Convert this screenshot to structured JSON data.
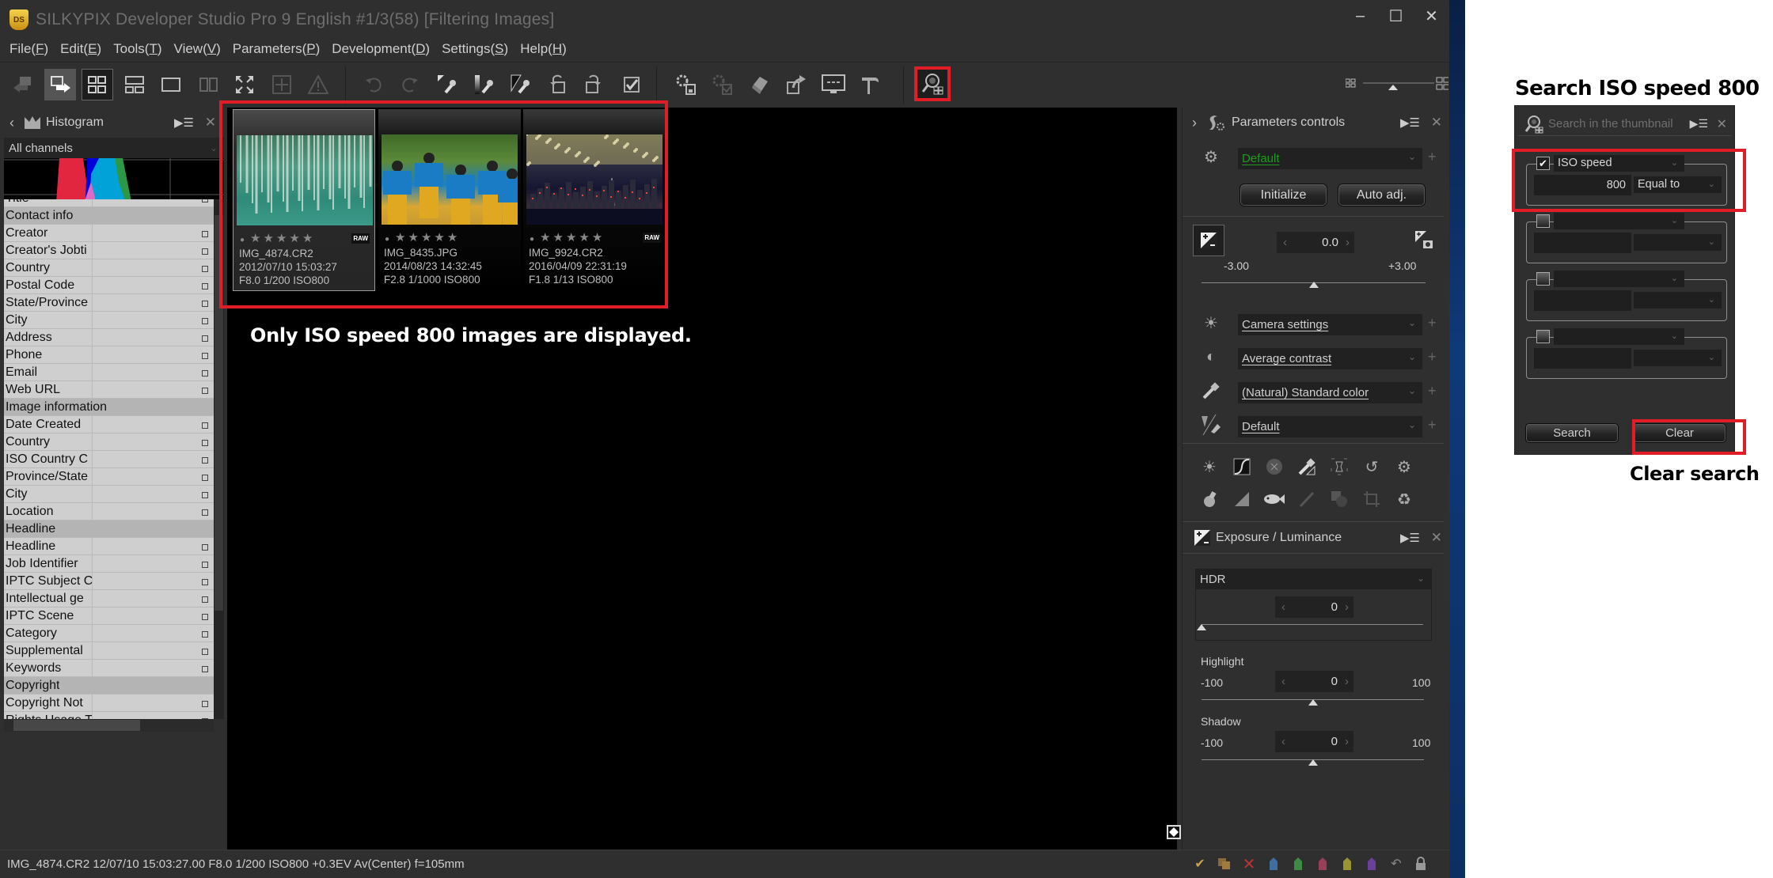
{
  "window": {
    "title": "SILKYPIX Developer Studio Pro 9 English   #1/3(58) [Filtering Images]",
    "logo": "DS",
    "controls": {
      "minimize": "–",
      "maximize": "☐",
      "close": "✕"
    }
  },
  "menu": [
    {
      "label": "File",
      "key": "F"
    },
    {
      "label": "Edit",
      "key": "E"
    },
    {
      "label": "Tools",
      "key": "T"
    },
    {
      "label": "View",
      "key": "V"
    },
    {
      "label": "Parameters",
      "key": "P"
    },
    {
      "label": "Development",
      "key": "D"
    },
    {
      "label": "Settings",
      "key": "S"
    },
    {
      "label": "Help",
      "key": "H"
    }
  ],
  "toolbar": {
    "icons": [
      "back-icon",
      "forward-icon",
      "grid-view-icon",
      "combined-view-icon",
      "preview-view-icon",
      "compare-view-icon",
      "fullscreen-icon",
      "navigator-icon",
      "warning-icon",
      "undo-icon",
      "redo-icon",
      "white-balance-picker-icon",
      "gray-picker-icon",
      "black-picker-icon",
      "rotate-left-icon",
      "rotate-right-icon",
      "mark-check-icon",
      "save-parameters-icon",
      "apply-parameters-icon",
      "print-icon",
      "export-icon",
      "display-icon",
      "develop-tool-icon",
      "search-thumbnail-icon"
    ]
  },
  "left_panel": {
    "histogram_title": "Histogram",
    "channel": "All channels",
    "iptc_rows": [
      {
        "label": "Title",
        "group": false,
        "partial": true
      },
      {
        "label": "Contact info",
        "group": true
      },
      {
        "label": "Creator",
        "group": false
      },
      {
        "label": "Creator's Jobti",
        "group": false
      },
      {
        "label": "Country",
        "group": false
      },
      {
        "label": "Postal Code",
        "group": false
      },
      {
        "label": "State/Province",
        "group": false
      },
      {
        "label": "City",
        "group": false
      },
      {
        "label": "Address",
        "group": false
      },
      {
        "label": "Phone",
        "group": false
      },
      {
        "label": "Email",
        "group": false
      },
      {
        "label": "Web URL",
        "group": false
      },
      {
        "label": "Image information",
        "group": true
      },
      {
        "label": "Date Created",
        "group": false
      },
      {
        "label": "Country",
        "group": false
      },
      {
        "label": "ISO Country C",
        "group": false
      },
      {
        "label": "Province/State",
        "group": false
      },
      {
        "label": "City",
        "group": false
      },
      {
        "label": "Location",
        "group": false
      },
      {
        "label": "Headline",
        "group": true
      },
      {
        "label": "Headline",
        "group": false
      },
      {
        "label": "Job Identifier",
        "group": false
      },
      {
        "label": "IPTC Subject C",
        "group": false
      },
      {
        "label": "Intellectual ge",
        "group": false
      },
      {
        "label": "IPTC Scene",
        "group": false
      },
      {
        "label": "Category",
        "group": false
      },
      {
        "label": "Supplemental",
        "group": false
      },
      {
        "label": "Keywords",
        "group": false
      },
      {
        "label": "Copyright",
        "group": true
      },
      {
        "label": "Copyright Not",
        "group": false
      },
      {
        "label": "Rights Usage T",
        "group": false
      }
    ]
  },
  "thumbnails": [
    {
      "filename": "IMG_4874.CR2",
      "datetime": "2012/07/10 15:03:27",
      "exposure": "F8.0 1/200 ISO800",
      "raw": true,
      "selected": true,
      "stars": "★★★★★",
      "theme": "forest-lake"
    },
    {
      "filename": "IMG_8435.JPG",
      "datetime": "2014/08/23 14:32:45",
      "exposure": "F2.8 1/1000 ISO800",
      "raw": false,
      "selected": false,
      "stars": "★★★★★",
      "theme": "dancers"
    },
    {
      "filename": "IMG_9924.CR2",
      "datetime": "2016/04/09 22:31:19",
      "exposure": "F1.8 1/13 ISO800",
      "raw": true,
      "selected": false,
      "stars": "★★★★★",
      "theme": "night-city"
    }
  ],
  "annotations": {
    "center": "Only ISO speed  800 images are displayed.",
    "search_title": "Search ISO speed 800",
    "clear": "Clear search"
  },
  "raw_label": "RAW",
  "params_panel": {
    "title": "Parameters controls",
    "preset": "Default",
    "initialize": "Initialize",
    "auto_adj": "Auto adj.",
    "exposure_value": "0.0",
    "exposure_min": "-3.00",
    "exposure_max": "+3.00",
    "exposure_fraction": 0.5,
    "white_balance": "Camera settings",
    "tone": "Average contrast",
    "color": "(Natural) Standard color",
    "sharpness": "Default"
  },
  "exposure_panel": {
    "title": "Exposure / Luminance",
    "mode": "HDR",
    "hdr_value": "0",
    "hdr_fraction": 0.0,
    "highlight_label": "Highlight",
    "highlight_value": "0",
    "highlight_min": "-100",
    "highlight_max": "100",
    "highlight_fraction": 0.5,
    "shadow_label": "Shadow",
    "shadow_value": "0",
    "shadow_min": "-100",
    "shadow_max": "100",
    "shadow_fraction": 0.5
  },
  "status": {
    "text": "IMG_4874.CR2 12/07/10 15:03:27.00 F8.0 1/200 ISO800 +0.3EV Av(Center) f=105mm"
  },
  "search_panel": {
    "placeholder": "Search in the thumbnail",
    "conditions": [
      {
        "checked": true,
        "field": "ISO speed",
        "value": "800",
        "operator": "Equal to"
      },
      {
        "checked": false,
        "field": "",
        "value": "",
        "operator": ""
      },
      {
        "checked": false,
        "field": "",
        "value": "",
        "operator": ""
      },
      {
        "checked": false,
        "field": "",
        "value": "",
        "operator": ""
      }
    ],
    "search_button": "Search",
    "clear_button": "Clear"
  },
  "colors": {
    "highlight_red": "#e11d27",
    "app_bg": "#2f2f2f",
    "preset_green": "#1f9a1f"
  }
}
